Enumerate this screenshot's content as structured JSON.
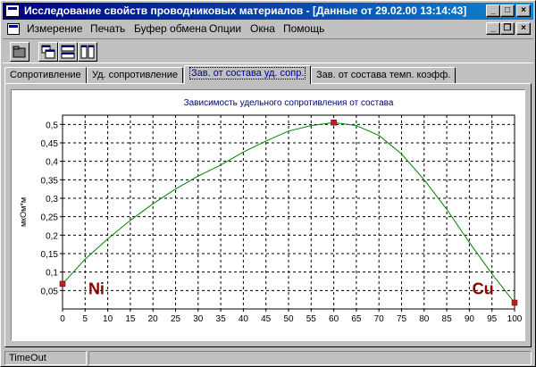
{
  "window": {
    "title": "Исследование свойств проводниковых материалов - [Данные от 29.02.00 13:14:43]",
    "controls": {
      "minimize": "_",
      "maximize": "□",
      "close": "×"
    }
  },
  "menu": {
    "items": [
      "Измерение",
      "Печать",
      "Буфер обмена",
      "Опции",
      "Окна",
      "Помощь"
    ]
  },
  "tabs": [
    {
      "label": "Сопротивление"
    },
    {
      "label": "Уд. сопротивление"
    },
    {
      "label": "Зав. от состава уд. сопр.",
      "active": true
    },
    {
      "label": "Зав. от состава темп. коэфф."
    }
  ],
  "chart_data": {
    "type": "line",
    "title": "Зависимость удельного сопротивления от состава",
    "xlabel": "",
    "ylabel": "мкОм*м",
    "xlim": [
      0,
      100
    ],
    "ylim": [
      0,
      0.525
    ],
    "xticks": [
      0,
      5,
      10,
      15,
      20,
      25,
      30,
      35,
      40,
      45,
      50,
      55,
      60,
      65,
      70,
      75,
      80,
      85,
      90,
      95,
      100
    ],
    "yticks": [
      0.05,
      0.1,
      0.15,
      0.2,
      0.25,
      0.3,
      0.35,
      0.4,
      0.45,
      0.5
    ],
    "ytick_labels": [
      "0,05",
      "0,1",
      "0,15",
      "0,2",
      "0,25",
      "0,3",
      "0,35",
      "0,4",
      "0,45",
      "0,5"
    ],
    "grid": true,
    "line_color": "#008000",
    "marker_color": "#b22222",
    "points": [
      {
        "x": 0,
        "y": 0.068
      },
      {
        "x": 60,
        "y": 0.505
      },
      {
        "x": 100,
        "y": 0.017
      }
    ],
    "curve": [
      [
        0,
        0.068
      ],
      [
        5,
        0.135
      ],
      [
        10,
        0.19
      ],
      [
        15,
        0.24
      ],
      [
        20,
        0.285
      ],
      [
        25,
        0.325
      ],
      [
        30,
        0.36
      ],
      [
        35,
        0.39
      ],
      [
        40,
        0.425
      ],
      [
        45,
        0.455
      ],
      [
        50,
        0.482
      ],
      [
        55,
        0.497
      ],
      [
        60,
        0.505
      ],
      [
        65,
        0.497
      ],
      [
        70,
        0.47
      ],
      [
        75,
        0.42
      ],
      [
        80,
        0.35
      ],
      [
        85,
        0.27
      ],
      [
        90,
        0.18
      ],
      [
        95,
        0.095
      ],
      [
        100,
        0.017
      ]
    ],
    "annotations": [
      {
        "text": "Ni",
        "x": 7.5,
        "y": 0.04
      },
      {
        "text": "Cu",
        "x": 93,
        "y": 0.04
      }
    ]
  },
  "status": {
    "text": "TimeOut"
  }
}
